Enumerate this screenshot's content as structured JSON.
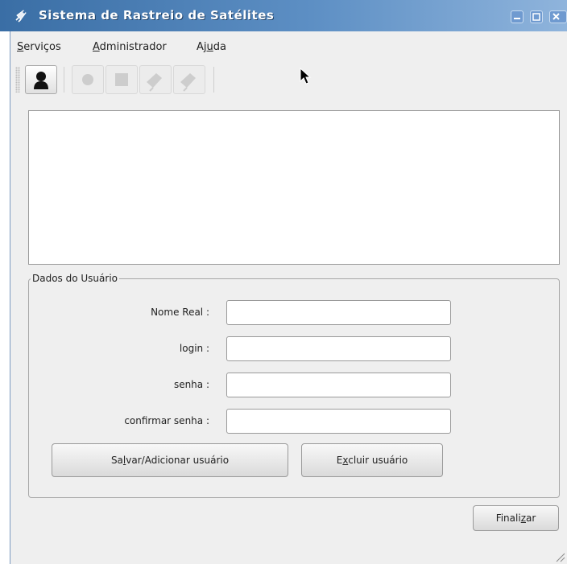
{
  "window": {
    "title": "Sistema de Rastreio de Satélites"
  },
  "menu": {
    "items": [
      {
        "pre": "",
        "key": "S",
        "post": "erviços"
      },
      {
        "pre": "",
        "key": "A",
        "post": "dministrador"
      },
      {
        "pre": "Aj",
        "key": "u",
        "post": "da"
      }
    ]
  },
  "toolbar": {
    "buttons": [
      {
        "icon": "user-icon",
        "enabled": true
      },
      {
        "icon": "circle-record-icon",
        "enabled": false
      },
      {
        "icon": "square-stop-icon",
        "enabled": false
      },
      {
        "icon": "satellite-dish-icon",
        "enabled": false
      },
      {
        "icon": "satellite-dish-icon",
        "enabled": false
      }
    ]
  },
  "user_group": {
    "legend": "Dados do Usuário",
    "fields": {
      "real_name": {
        "label": "Nome Real :",
        "value": ""
      },
      "login": {
        "label": "login :",
        "value": ""
      },
      "password": {
        "label": "senha :",
        "value": ""
      },
      "confirm_password": {
        "label": "confirmar senha :",
        "value": ""
      }
    },
    "save_button": {
      "pre": "Sa",
      "key": "l",
      "post": "var/Adicionar usuário"
    },
    "delete_button": {
      "pre": "E",
      "key": "x",
      "post": "cluir usuário"
    }
  },
  "finish_button": {
    "pre": "Finali",
    "key": "z",
    "post": "ar"
  },
  "colors": {
    "titlebar": "#3a6ea5",
    "window_bg": "#efefef",
    "accent": "#6f9ad0"
  }
}
